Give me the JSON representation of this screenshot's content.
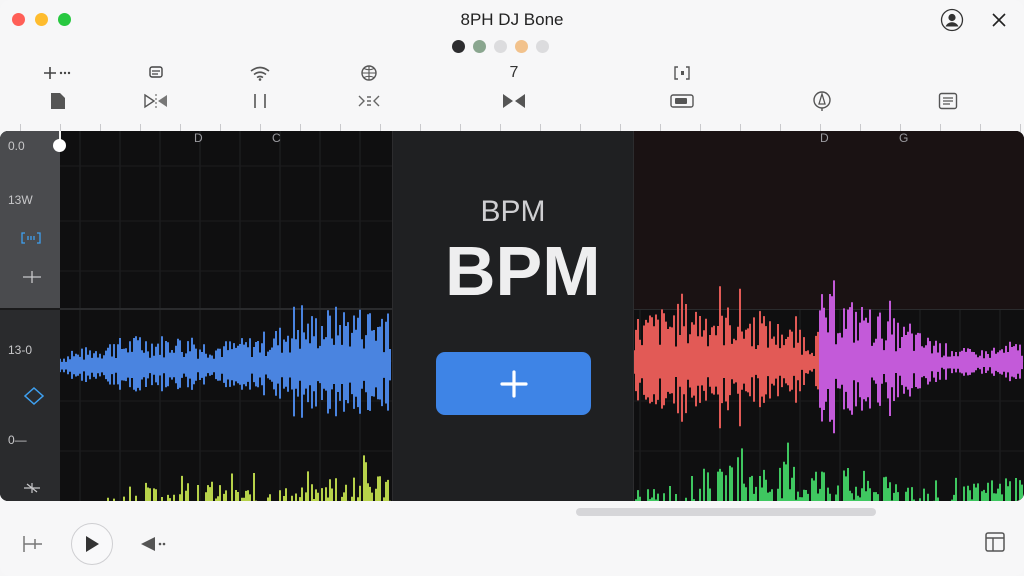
{
  "window": {
    "title": "8PH DJ Bone",
    "traffic_lights": {
      "close": "#ff5f57",
      "minimize": "#febc2e",
      "zoom": "#28c840"
    },
    "right_icons": [
      "account-icon",
      "close-icon"
    ]
  },
  "page_dots": {
    "colors": [
      "#2d2d2f",
      "#8aa68f",
      "#dcdcde",
      "#f2c28c",
      "#dcdcde"
    ]
  },
  "toolbar": {
    "tools": [
      {
        "name": "add-marker",
        "top_icon": "add-marker-icon",
        "bottom_icon": "file-icon"
      },
      {
        "name": "chip",
        "top_icon": "chip-icon",
        "bottom_icon": "flip-icon"
      },
      {
        "name": "wifi",
        "top_icon": "wifi-icon",
        "bottom_icon": "pause-bars-icon"
      },
      {
        "name": "globe",
        "top_icon": "globe-icon",
        "bottom_icon": "mix-icon"
      },
      {
        "name": "count",
        "top_text": "7",
        "bottom_icon": "bowtie-icon"
      },
      {
        "name": "bracket",
        "top_icon": "bracket-icon",
        "bottom_icon": "display-icon"
      },
      {
        "name": "compass",
        "bottom_icon": "compass-icon"
      },
      {
        "name": "notes",
        "bottom_icon": "list-icon"
      }
    ]
  },
  "ruler": {
    "bar_labels": [
      "D",
      "C",
      "D",
      "G"
    ]
  },
  "lanes": {
    "labels": [
      "0.0",
      "13W",
      "13-0",
      "0—"
    ],
    "top_controls": [
      "loop-icon",
      "crosshair-icon"
    ],
    "bottom_controls": [
      "diamond-icon",
      "star-icon"
    ]
  },
  "center_panel": {
    "bpm_label": "BPM",
    "bpm_value": "BPM",
    "add_button_icon": "plus-icon"
  },
  "colors": {
    "blue_wave": "#4a84e0",
    "yellow_wave": "#b7d24a",
    "red_wave": "#e25a56",
    "magenta_wave": "#c35ad9",
    "green_wave": "#3fc760",
    "accent": "#3e84e6"
  },
  "bottombar": {
    "transport_icons": [
      "split-icon",
      "play-icon",
      "rewind-icon",
      "layout-icon"
    ]
  }
}
